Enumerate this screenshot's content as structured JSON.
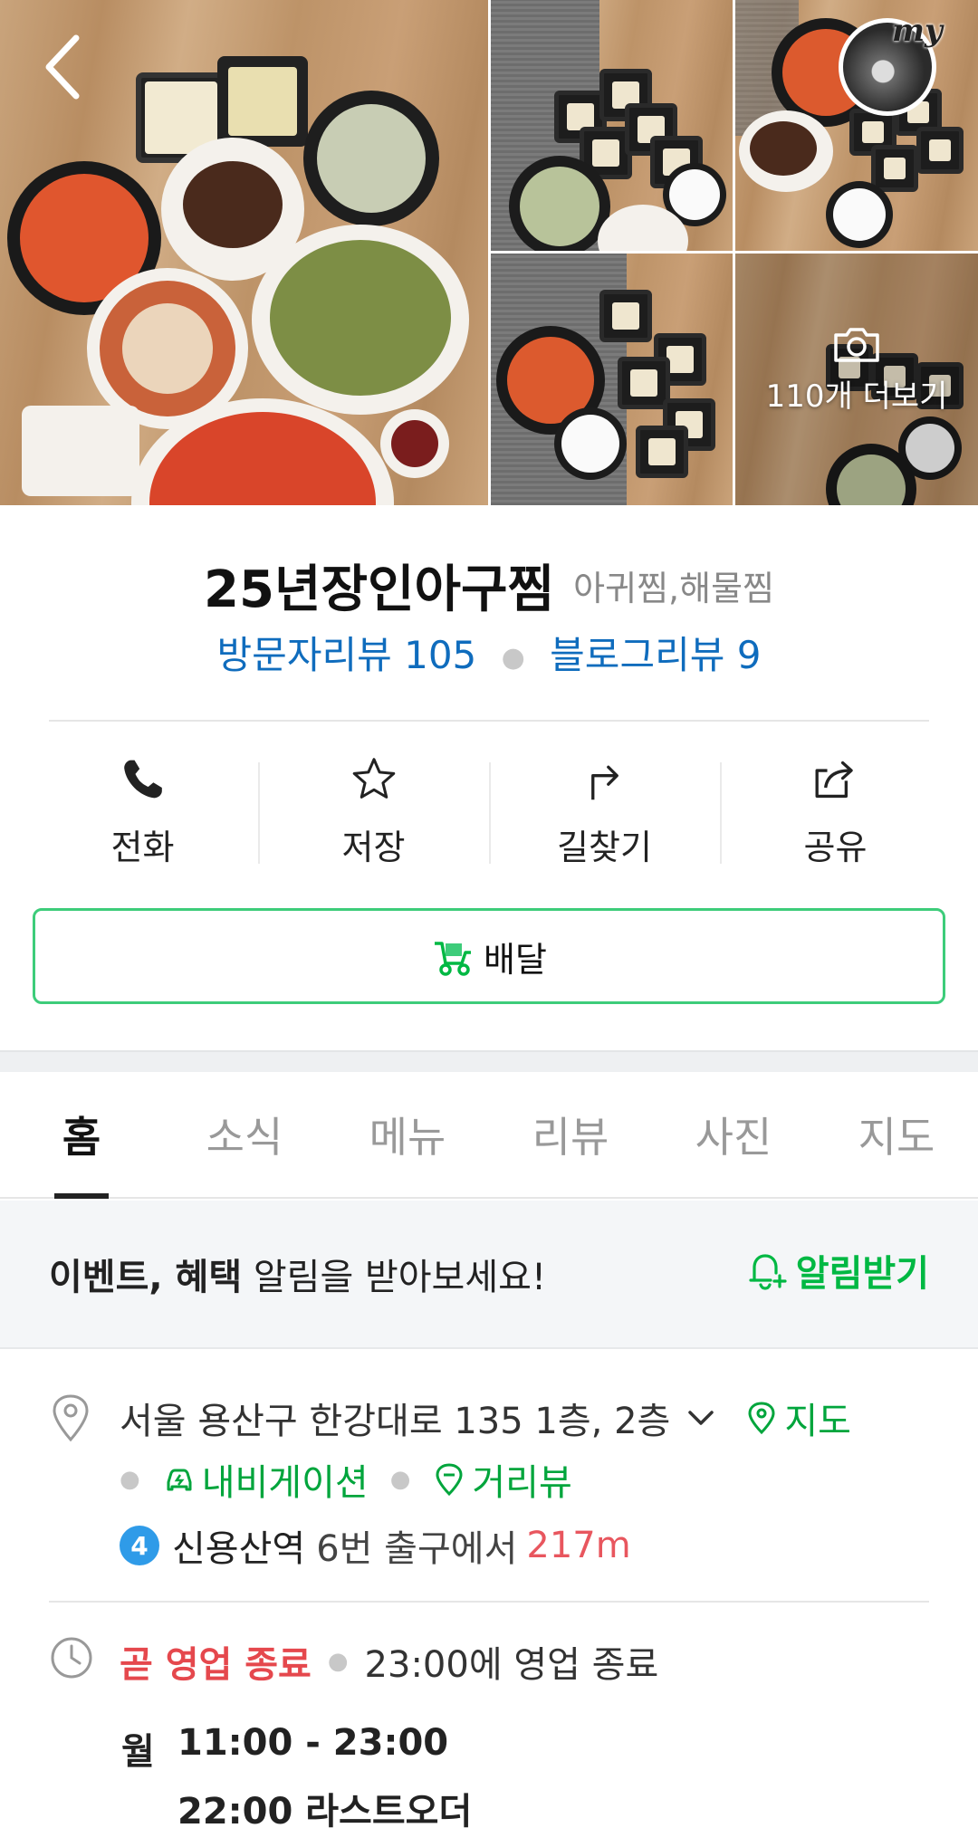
{
  "place": {
    "name": "25년장인아구찜",
    "category": "아귀찜,해물찜",
    "visitor_reviews": "방문자리뷰 105",
    "blog_reviews": "블로그리뷰 9"
  },
  "gallery": {
    "more_photos": "110개 더보기",
    "profile_tag": "my"
  },
  "actions": [
    {
      "label": "전화",
      "icon": "phone-icon"
    },
    {
      "label": "저장",
      "icon": "star-icon"
    },
    {
      "label": "길찾기",
      "icon": "directions-icon"
    },
    {
      "label": "공유",
      "icon": "share-icon"
    }
  ],
  "delivery": {
    "label": "배달",
    "icon": "delivery-truck-icon"
  },
  "tabs": [
    {
      "label": "홈",
      "active": true
    },
    {
      "label": "소식",
      "active": false
    },
    {
      "label": "메뉴",
      "active": false
    },
    {
      "label": "리뷰",
      "active": false
    },
    {
      "label": "사진",
      "active": false
    },
    {
      "label": "지도",
      "active": false
    }
  ],
  "notice": {
    "bold_text": "이벤트, 혜택",
    "text": " 알림을 받아보세요!",
    "button": "알림받기"
  },
  "address": {
    "text": "서울 용산구 한강대로 135 1층, 2층",
    "map_link": "지도",
    "navigation_link": "내비게이션",
    "streetview_link": "거리뷰",
    "subway_line": "4",
    "station": "신용산역",
    "exit_text": "6번 출구에서",
    "distance": "217m"
  },
  "hours": {
    "status": "곧 영업 종료",
    "summary": "23:00에 영업 종료",
    "day": "월",
    "time": "11:00 - 23:00",
    "last_order": "22:00 라스트오더"
  },
  "colors": {
    "accent_green": "#00a53c",
    "link_blue": "#0f6cbd",
    "alert_red": "#e5484d",
    "subway_line4": "#2f9be8"
  }
}
